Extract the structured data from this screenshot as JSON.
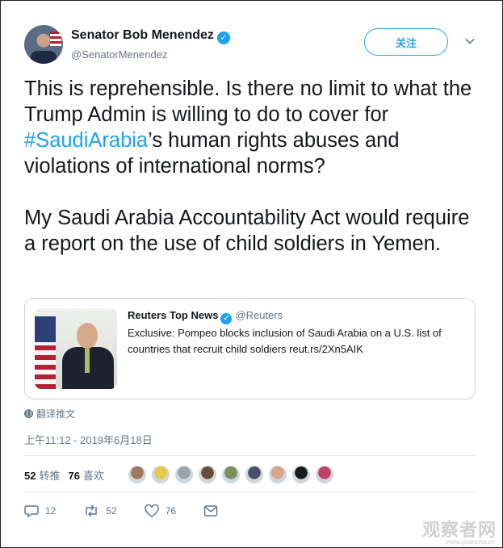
{
  "author": {
    "name": "Senator Bob Menendez",
    "handle": "@SenatorMenendez",
    "follow_label": "关注"
  },
  "tweet": {
    "text_before": "This is reprehensible. Is there no limit to what the Trump Admin is willing to do to cover for ",
    "hashtag": "#SaudiArabia",
    "text_after": "’s human rights abuses and violations of international norms?\n\nMy Saudi Arabia Accountability Act would require a report on the use of child soldiers in Yemen."
  },
  "quoted": {
    "name": "Reuters Top News",
    "handle": "@Reuters",
    "text": "Exclusive: Pompeo blocks inclusion of Saudi Arabia on a U.S. list of countries that recruit child soldiers reut.rs/2Xn5AIK"
  },
  "translate_label": "翻译推文",
  "timestamp": "上午11:12 - 2019年6月18日",
  "stats": {
    "retweets_count": "52",
    "retweets_label": "转推",
    "likes_count": "76",
    "likes_label": "喜欢"
  },
  "liker_avatars": [
    "#a0785a",
    "#e3c84a",
    "#9aa3ad",
    "#6b4a3a",
    "#7a8f5a",
    "#4a4f6a",
    "#d8a78a",
    "#1a1a1a",
    "#c0406a"
  ],
  "actions": {
    "reply_count": "12",
    "retweet_count": "52",
    "like_count": "76"
  },
  "watermark": "观察者网",
  "watermark_sub": "www.guancha.cn",
  "colors": {
    "accent": "#1da1f2",
    "muted": "#657786",
    "text": "#14171a"
  }
}
